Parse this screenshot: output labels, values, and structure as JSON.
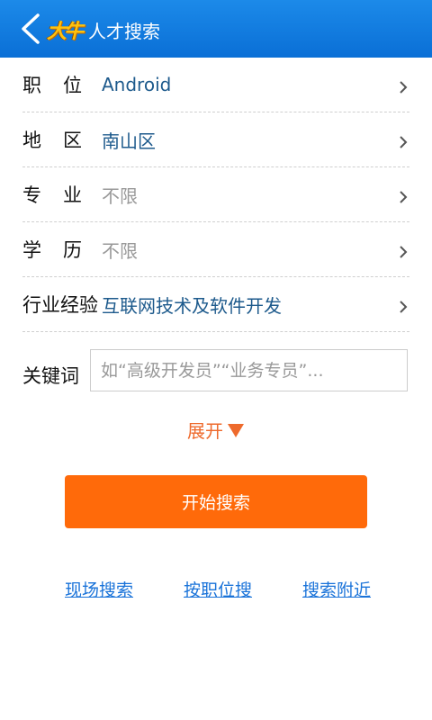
{
  "header": {
    "logo_text": "大牛",
    "title": "人才搜索",
    "bg_color": "#0a6fd6"
  },
  "form": {
    "rows": [
      {
        "label": "职位",
        "value": "Android",
        "muted": false
      },
      {
        "label": "地区",
        "value": "南山区",
        "muted": false
      },
      {
        "label": "专业",
        "value": "不限",
        "muted": true
      },
      {
        "label": "学历",
        "value": "不限",
        "muted": true
      },
      {
        "label": "行业经验",
        "value": "互联网技术及软件开发",
        "muted": false
      }
    ],
    "keyword": {
      "label": "关键词",
      "value": "",
      "placeholder": "如“高级开发员”“业务专员”..."
    },
    "expand_label": "展开"
  },
  "actions": {
    "search_label": "开始搜索",
    "accent_color": "#ff6a0a"
  },
  "links": [
    {
      "label": "现场搜索"
    },
    {
      "label": "按职位搜"
    },
    {
      "label": "搜索附近"
    }
  ]
}
